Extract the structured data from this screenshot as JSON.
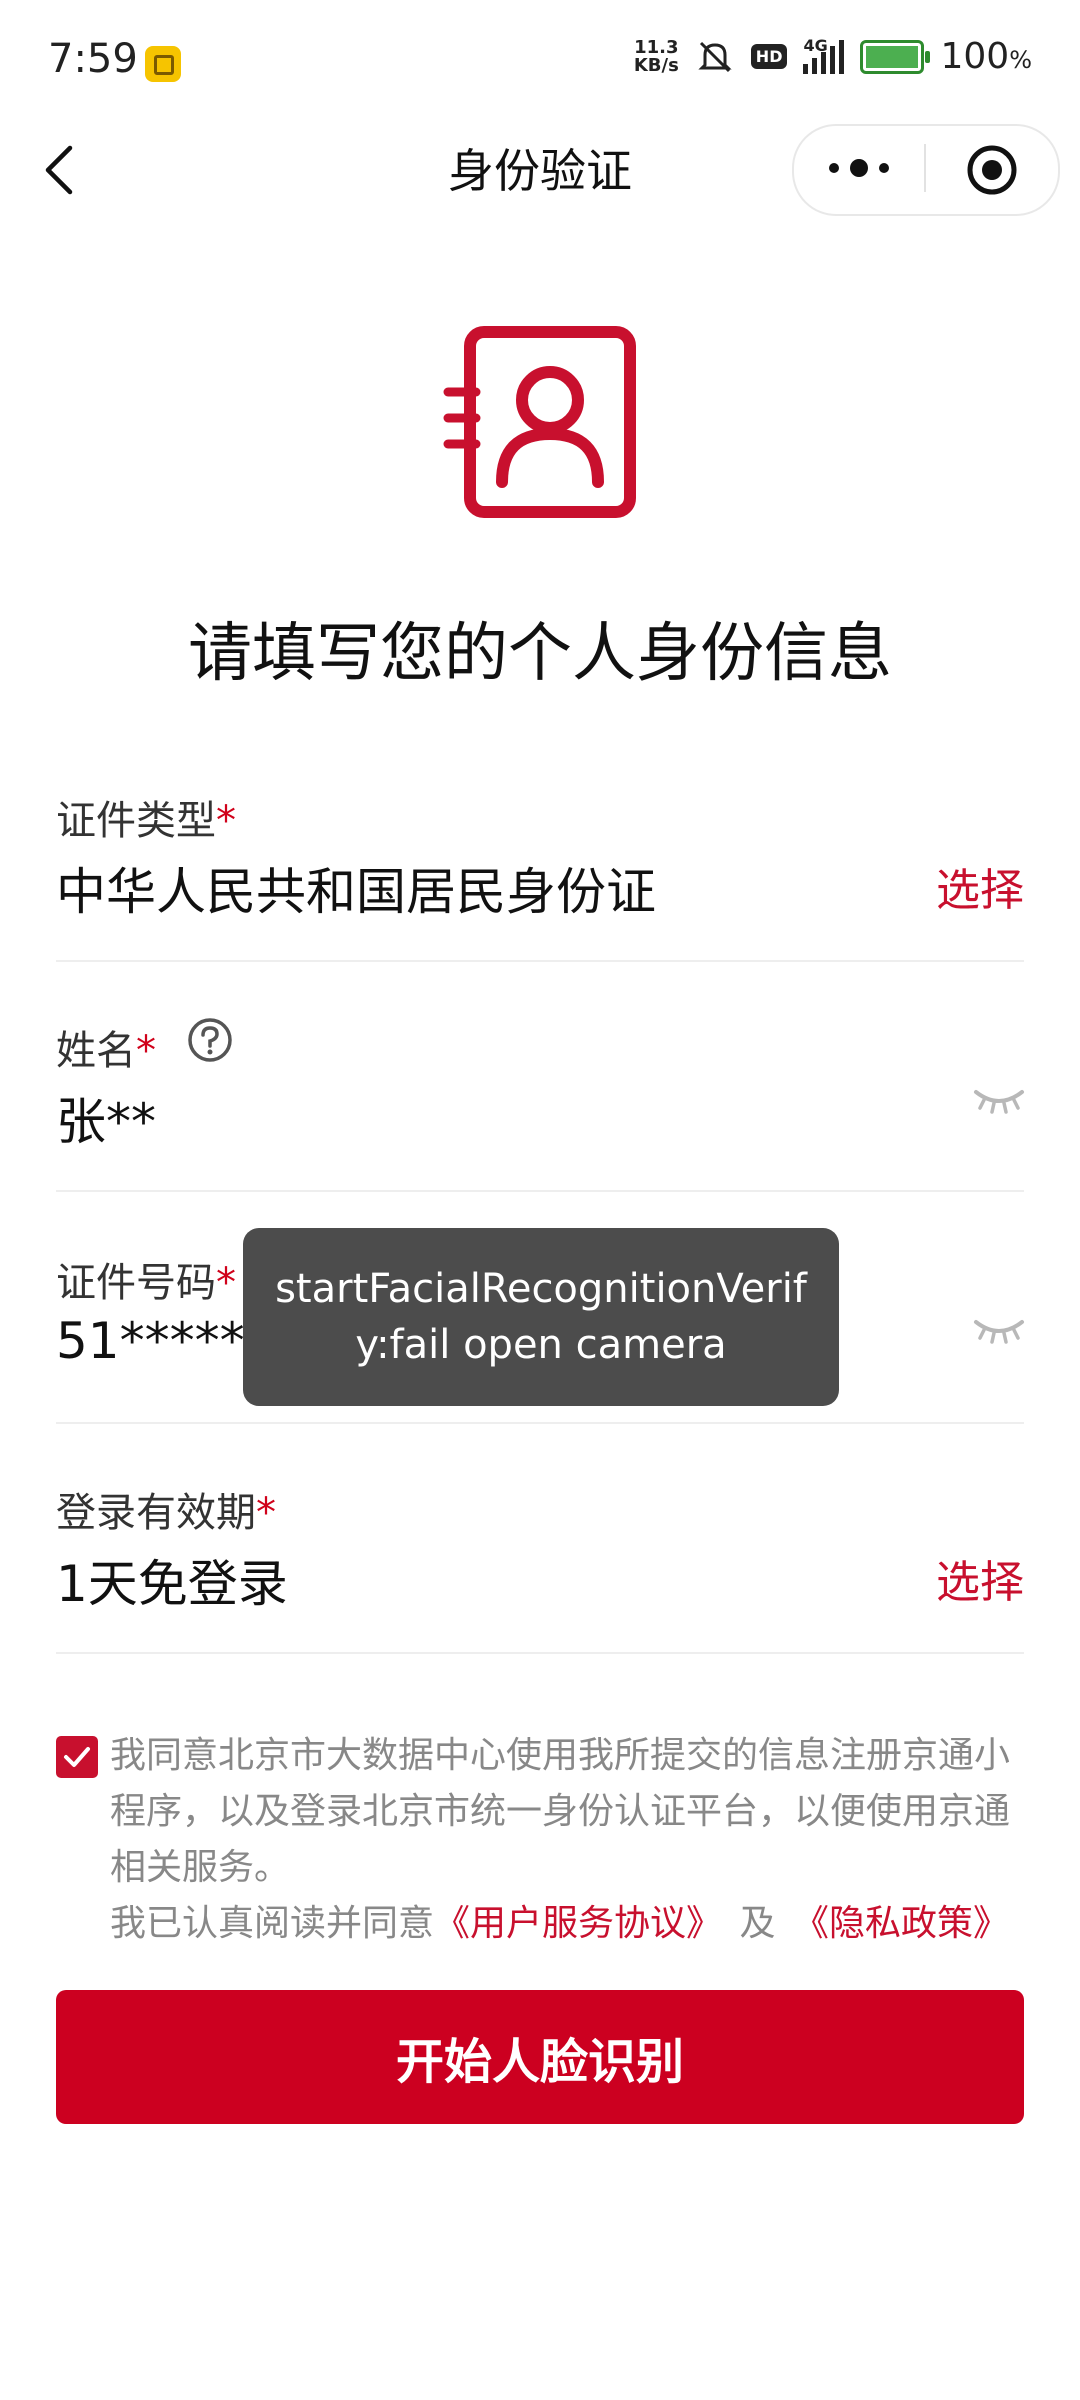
{
  "status_bar": {
    "time": "7:59",
    "net_speed_value": "11.3",
    "net_speed_unit": "KB/s",
    "hd_badge": "HD",
    "network_type": "4G",
    "battery": "100",
    "battery_unit": "%"
  },
  "header": {
    "title": "身份验证",
    "icons": [
      "back-arrow-icon",
      "more-dots-icon",
      "close-circle-icon"
    ]
  },
  "hero": {
    "icon": "id-card-person-icon",
    "heading": "请填写您的个人身份信息"
  },
  "form": {
    "required_mark": "*",
    "id_type": {
      "label": "证件类型",
      "value": "中华人民共和国居民身份证",
      "action": "选择"
    },
    "name": {
      "label": "姓名",
      "value": "张**"
    },
    "id_number": {
      "label": "证件号码",
      "value": "51******"
    },
    "login_validity": {
      "label": "登录有效期",
      "value": "1天免登录",
      "action": "选择"
    }
  },
  "toast": {
    "message": "startFacialRecognitionVerify:fail open camera"
  },
  "agreement": {
    "checked": true,
    "text": "我同意北京市大数据中心使用我所提交的信息注册京通小程序，以及登录北京市统一身份认证平台，以便使用京通相关服务。",
    "read_prefix": "我已认真阅读并同意",
    "user_agreement_link": "《用户服务协议》",
    "conjunction": "及",
    "privacy_link": "《隐私政策》"
  },
  "cta": {
    "label": "开始人脸识别"
  },
  "colors": {
    "brand_red": "#c8102e",
    "toast_bg": "#4c4c4c"
  }
}
